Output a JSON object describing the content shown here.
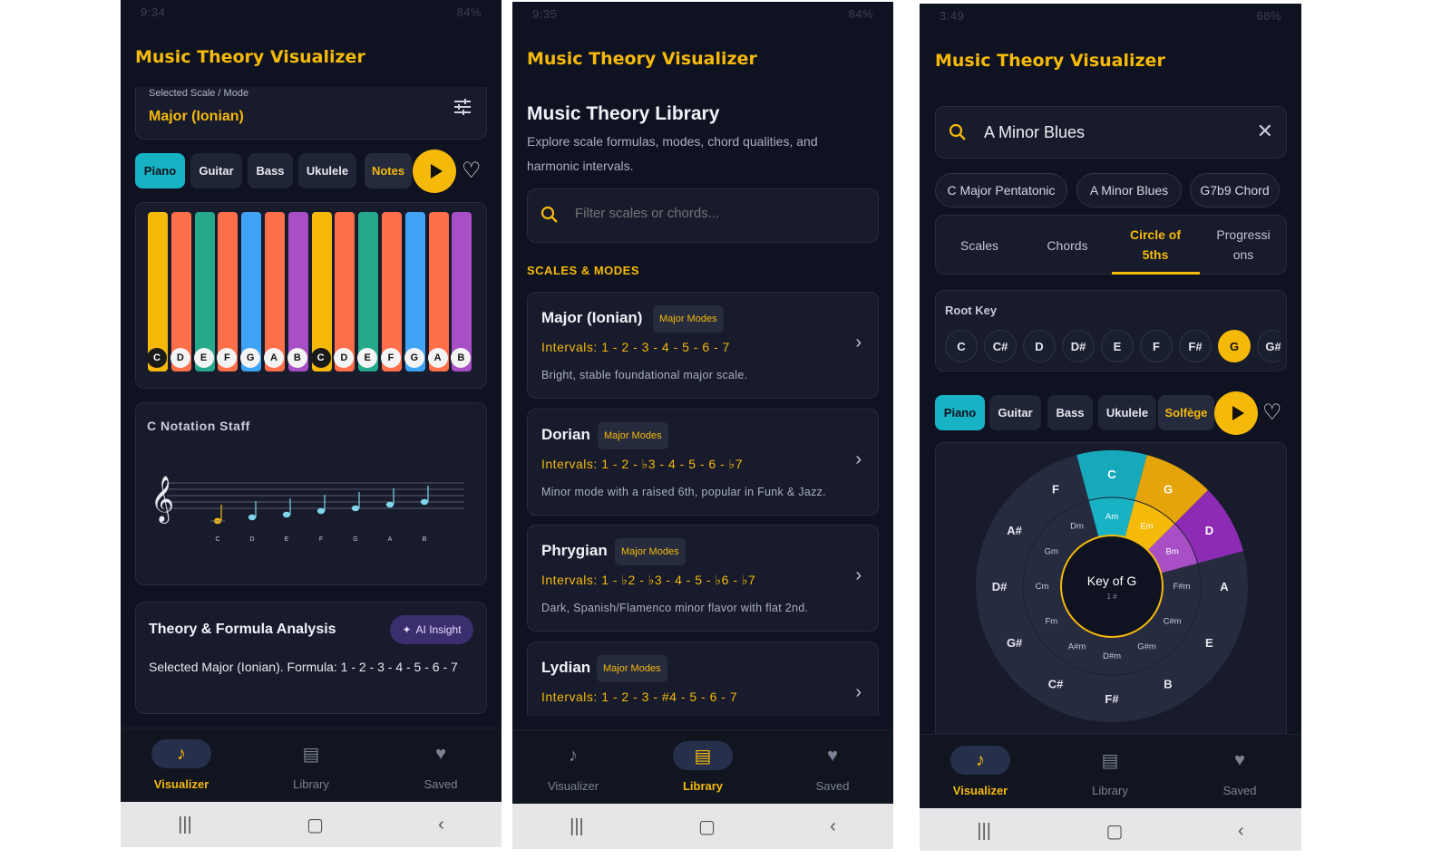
{
  "app_title": "Music Theory Visualizer",
  "screen1": {
    "status_time": "9:34",
    "status_right": "84%",
    "selected_label": "Selected Scale / Mode",
    "selected_value": "Major (Ionian)",
    "instruments": [
      "Piano",
      "Guitar",
      "Bass",
      "Ukulele",
      "Notes"
    ],
    "piano_keys": [
      {
        "note": "C",
        "color": "#f5b90a",
        "dark": true
      },
      {
        "note": "D",
        "color": "#ff6f4a",
        "dark": false
      },
      {
        "note": "E",
        "color": "#25a98a",
        "dark": false
      },
      {
        "note": "F",
        "color": "#ff6f4a",
        "dark": false
      },
      {
        "note": "G",
        "color": "#3fa3f5",
        "dark": false
      },
      {
        "note": "A",
        "color": "#ff6f4a",
        "dark": false
      },
      {
        "note": "B",
        "color": "#a84fc6",
        "dark": false
      },
      {
        "note": "C",
        "color": "#f5b90a",
        "dark": true
      },
      {
        "note": "D",
        "color": "#ff6f4a",
        "dark": false
      },
      {
        "note": "E",
        "color": "#25a98a",
        "dark": false
      },
      {
        "note": "F",
        "color": "#ff6f4a",
        "dark": false
      },
      {
        "note": "G",
        "color": "#3fa3f5",
        "dark": false
      },
      {
        "note": "A",
        "color": "#ff6f4a",
        "dark": false
      },
      {
        "note": "B",
        "color": "#a84fc6",
        "dark": false
      }
    ],
    "staff_title": "C Notation Staff",
    "staff_notes": [
      "C",
      "D",
      "E",
      "F",
      "G",
      "A",
      "B"
    ],
    "analysis_title": "Theory & Formula Analysis",
    "ai_button": "AI Insight",
    "analysis_text": "Selected Major (Ionian). Formula: 1 - 2 - 3 - 4 - 5 - 6 - 7"
  },
  "screen2": {
    "status_time": "9:35",
    "status_right": "84%",
    "library_title": "Music Theory Library",
    "library_subtitle": "Explore scale formulas, modes, chord qualities, and harmonic intervals.",
    "filter_placeholder": "Filter scales or chords...",
    "section_label": "SCALES & MODES",
    "items": [
      {
        "name": "Major (Ionian)",
        "tag": "Major Modes",
        "intervals": "Intervals: 1 - 2 - 3 - 4 - 5 - 6 - 7",
        "desc": "Bright, stable foundational major scale."
      },
      {
        "name": "Dorian",
        "tag": "Major Modes",
        "intervals": "Intervals: 1 - 2 - ♭3 - 4 - 5 - 6 - ♭7",
        "desc": "Minor mode with a raised 6th, popular in Funk & Jazz."
      },
      {
        "name": "Phrygian",
        "tag": "Major Modes",
        "intervals": "Intervals: 1 - ♭2 - ♭3 - 4 - 5 - ♭6 - ♭7",
        "desc": "Dark, Spanish/Flamenco minor flavor with flat 2nd."
      },
      {
        "name": "Lydian",
        "tag": "Major Modes",
        "intervals": "Intervals: 1 - 2 - 3 - #4 - 5 - 6 - 7",
        "desc": ""
      }
    ]
  },
  "screen3": {
    "status_time": "3:49",
    "status_right": "68%",
    "search_value": "A Minor Blues",
    "recent": [
      "C Major Pentatonic",
      "A Minor Blues",
      "G7b9 Chord"
    ],
    "tabs": [
      "Scales",
      "Chords",
      "Circle of 5ths",
      "Progressions"
    ],
    "tab_display": [
      "Scales",
      "Chords",
      "Circle of\n5ths",
      "Progressi\nons"
    ],
    "root_label": "Root Key",
    "root_keys": [
      "C",
      "C#",
      "D",
      "D#",
      "E",
      "F",
      "F#",
      "G",
      "G#"
    ],
    "instruments": [
      "Piano",
      "Guitar",
      "Bass",
      "Ukulele",
      "Solfège"
    ],
    "circle_center": "Key of G",
    "circle_center_sub": "1 #",
    "majors": [
      "C",
      "G",
      "D",
      "A",
      "E",
      "B",
      "F#",
      "C#",
      "G#",
      "D#",
      "A#",
      "F"
    ],
    "minors": [
      "Am",
      "Em",
      "Bm",
      "F#m",
      "C#m",
      "G#m",
      "D#m",
      "A#m",
      "Fm",
      "Cm",
      "Gm",
      "Dm"
    ]
  },
  "nav": {
    "visualizer": "Visualizer",
    "library": "Library",
    "saved": "Saved"
  },
  "colors": {
    "accent": "#f5b90a",
    "teal": "#17b2c4",
    "purple": "#8e2bb5",
    "background": "#0f1220"
  }
}
